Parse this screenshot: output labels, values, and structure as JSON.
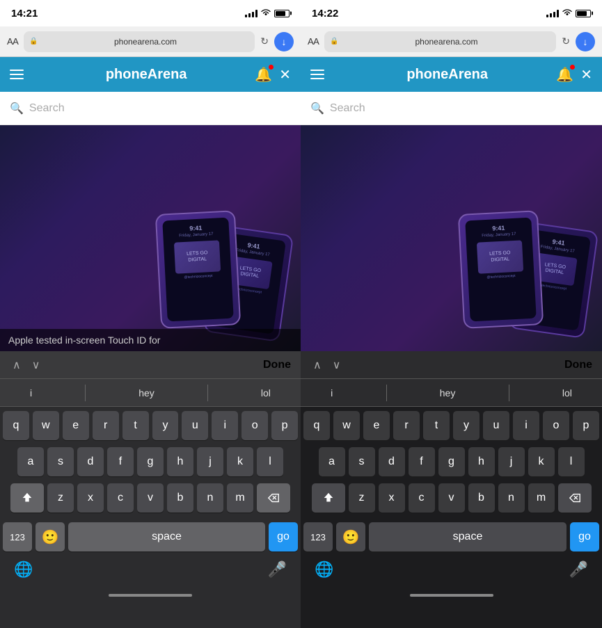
{
  "left": {
    "status": {
      "time": "14:21",
      "url": "phonearena.com"
    },
    "browser": {
      "aa": "AA",
      "url": "phonearena.com",
      "download_btn": "↓"
    },
    "header": {
      "title": "phoneArena",
      "close": "✕"
    },
    "search": {
      "placeholder": "Search"
    },
    "article": {
      "caption": "Apple tested in-screen Touch ID for"
    },
    "find_bar": {
      "up": "∧",
      "down": "∨",
      "done": "Done"
    },
    "autocomplete": {
      "words": [
        "i",
        "hey",
        "lol"
      ]
    },
    "keyboard": {
      "rows": [
        [
          "q",
          "w",
          "e",
          "r",
          "t",
          "y",
          "u",
          "i",
          "o",
          "p"
        ],
        [
          "a",
          "s",
          "d",
          "f",
          "g",
          "h",
          "j",
          "k",
          "l"
        ],
        [
          "z",
          "x",
          "c",
          "v",
          "b",
          "n",
          "m"
        ]
      ],
      "num": "123",
      "space": "space",
      "go": "go"
    }
  },
  "right": {
    "status": {
      "time": "14:22",
      "url": "phonearena.com"
    },
    "browser": {
      "aa": "AA",
      "url": "phonearena.com",
      "download_btn": "↓"
    },
    "header": {
      "title": "phoneArena",
      "close": "✕"
    },
    "search": {
      "placeholder": "Search"
    },
    "find_bar": {
      "up": "∧",
      "down": "∨",
      "done": "Done"
    },
    "autocomplete": {
      "words": [
        "i",
        "hey",
        "lol"
      ]
    },
    "keyboard": {
      "rows": [
        [
          "q",
          "w",
          "e",
          "r",
          "t",
          "y",
          "u",
          "i",
          "o",
          "p"
        ],
        [
          "a",
          "s",
          "d",
          "f",
          "g",
          "h",
          "j",
          "k",
          "l"
        ],
        [
          "z",
          "x",
          "c",
          "v",
          "b",
          "n",
          "m"
        ]
      ],
      "num": "123",
      "space": "space",
      "go": "go"
    }
  }
}
